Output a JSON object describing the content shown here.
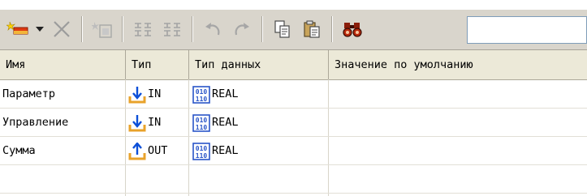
{
  "toolbar": {
    "buttons": [
      {
        "icon": "new-declaration-icon",
        "enabled": true
      },
      {
        "icon": "dropdown-arrow-icon",
        "enabled": true
      },
      {
        "icon": "delete-icon",
        "enabled": false
      },
      {
        "icon": "insert-row-icon",
        "enabled": false
      },
      {
        "icon": "cut-structure-icon",
        "enabled": false
      },
      {
        "icon": "paste-structure-icon",
        "enabled": false
      },
      {
        "icon": "undo-icon",
        "enabled": false
      },
      {
        "icon": "redo-icon",
        "enabled": false
      },
      {
        "icon": "copy-icon",
        "enabled": true
      },
      {
        "icon": "paste-icon",
        "enabled": true
      },
      {
        "icon": "find-binoculars-icon",
        "enabled": true
      }
    ],
    "search": {
      "value": "",
      "placeholder": ""
    }
  },
  "table": {
    "columns": [
      "Имя",
      "Тип",
      "Тип данных",
      "Значение по умолчанию"
    ],
    "rows": [
      {
        "name": "Параметр",
        "type": "IN",
        "type_icon": "input-arrow-down-icon",
        "datatype": "REAL",
        "datatype_icon": "real-type-icon",
        "default": ""
      },
      {
        "name": "Управление",
        "type": "IN",
        "type_icon": "input-arrow-down-icon",
        "datatype": "REAL",
        "datatype_icon": "real-type-icon",
        "default": ""
      },
      {
        "name": "Сумма",
        "type": "OUT",
        "type_icon": "output-arrow-up-icon",
        "datatype": "REAL",
        "datatype_icon": "real-type-icon",
        "default": ""
      },
      {
        "name": "",
        "type": "",
        "datatype": "",
        "default": ""
      }
    ]
  },
  "colors": {
    "toolbar_bg": "#d9d5cc",
    "header_bg": "#ece9d8",
    "arrow_blue": "#0c4fd8",
    "tray_orange": "#e8a22a",
    "datatype_blue": "#2a55c8"
  }
}
